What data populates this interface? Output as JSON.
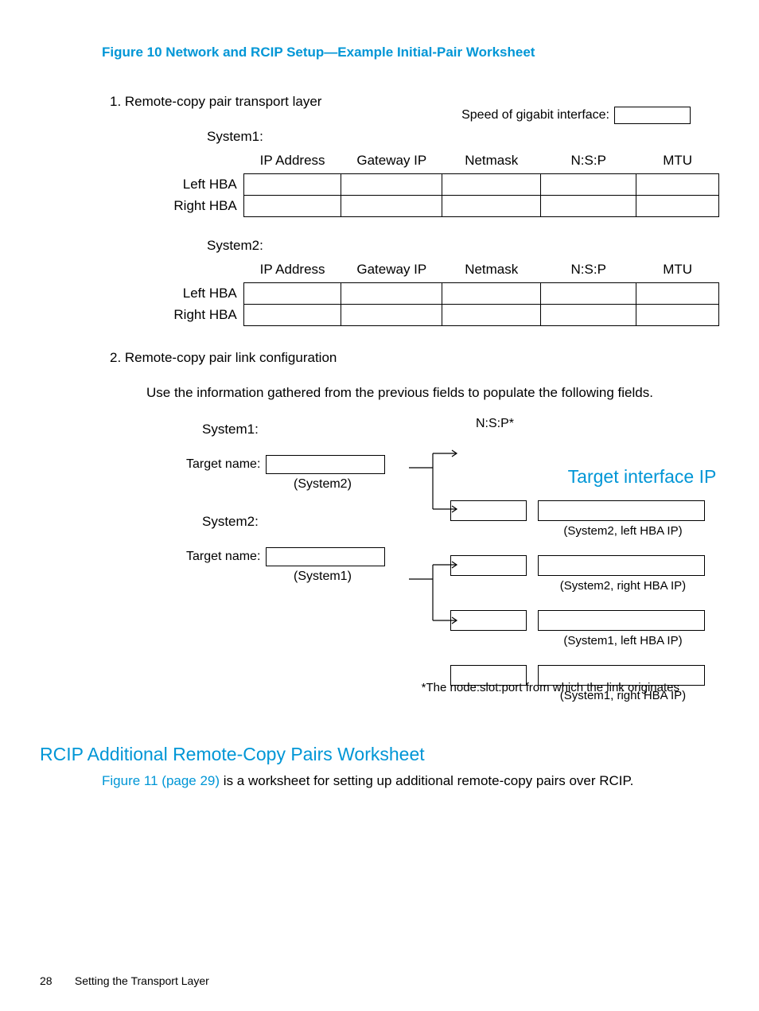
{
  "figure": {
    "caption": "Figure 10 Network and RCIP Setup—Example Initial-Pair Worksheet"
  },
  "section1": {
    "title": "1. Remote-copy pair transport layer",
    "speed_label": "Speed of gigabit interface:",
    "cols": {
      "ip": "IP Address",
      "gw": "Gateway IP",
      "nm": "Netmask",
      "nsp": "N:S:P",
      "mtu": "MTU"
    },
    "system1": "System1:",
    "system2": "System2:",
    "left_hba": "Left HBA",
    "right_hba": "Right HBA"
  },
  "section2": {
    "title": "2.  Remote-copy pair link configuration",
    "instr": "Use the information gathered from the previous fields to populate the following fields.",
    "system1": "System1:",
    "system2": "System2:",
    "target_name_label": "Target name:",
    "sub1": "(System2)",
    "sub2": "(System1)",
    "col_nsp": "N:S:P*",
    "col_tip": "Target interface IP",
    "ann": {
      "a": "(System2, left HBA IP)",
      "b": "(System2, right HBA IP)",
      "c": "(System1, left HBA IP)",
      "d": "(System1, right HBA IP)"
    },
    "footnote": "*The node:slot:port from which the link originates"
  },
  "h2": "RCIP Additional Remote-Copy Pairs Worksheet",
  "para": {
    "xref": "Figure 11 (page 29)",
    "rest": " is a worksheet for setting up additional remote-copy pairs over RCIP."
  },
  "footer": {
    "page": "28",
    "title": "Setting the Transport Layer"
  }
}
